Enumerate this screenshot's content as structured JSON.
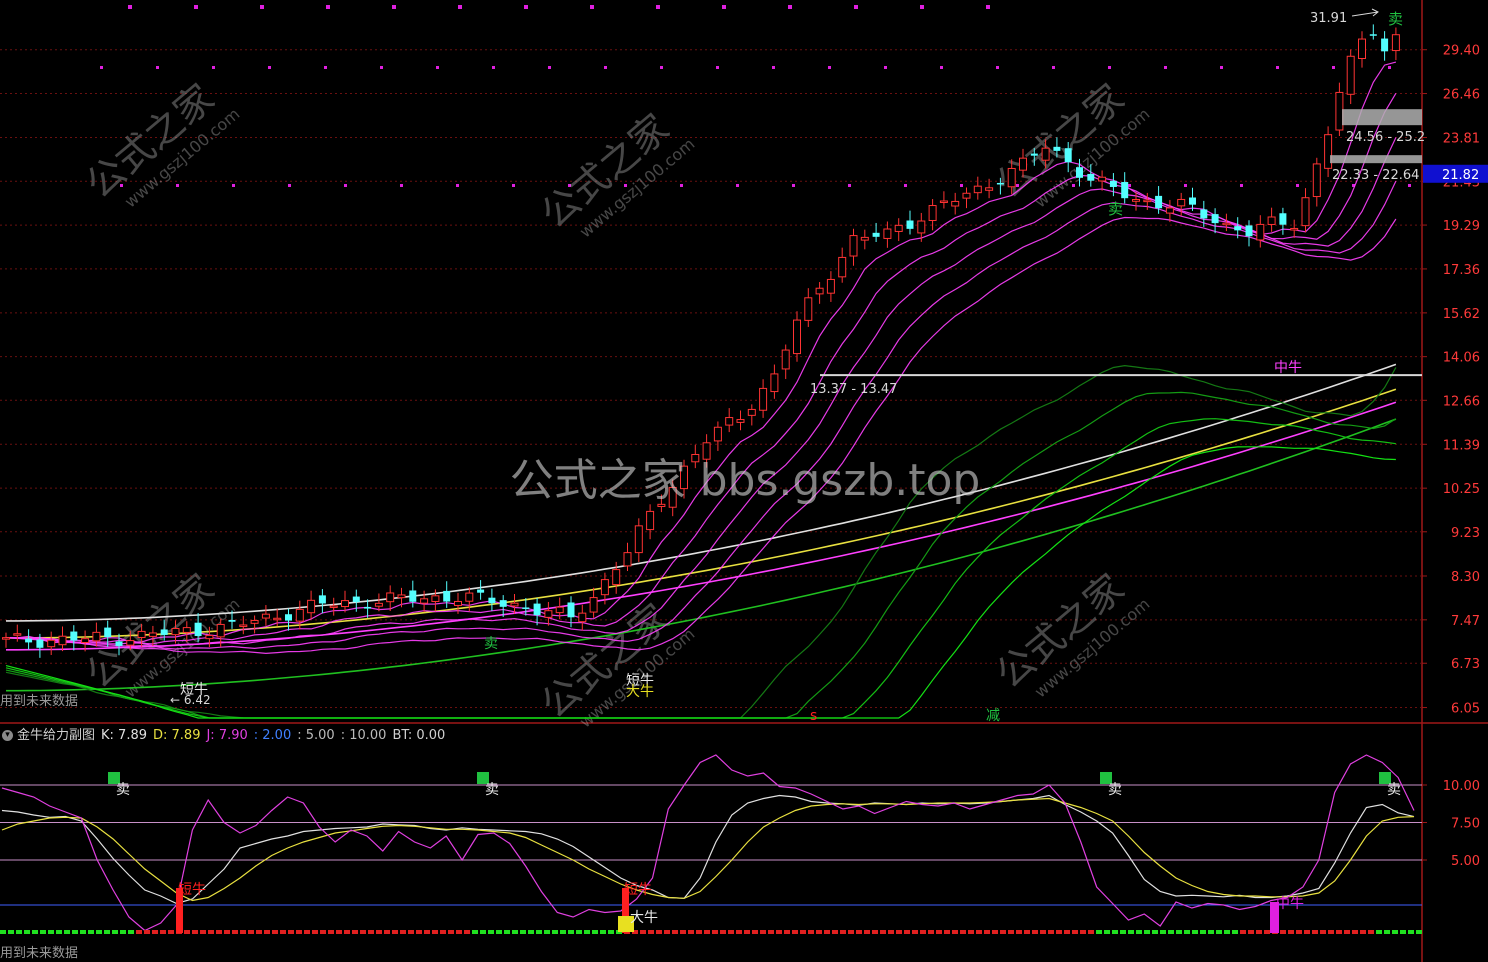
{
  "colors": {
    "background": "#000000",
    "frame": "#a01818",
    "grid": "#6a1010",
    "up": "#ff3333",
    "down": "#54ffff",
    "ma_short": "#ff40ff",
    "ma_long": "#20c020",
    "line_white": "#e0e0e0",
    "line_yellow": "#e8e040",
    "price_tag": "#1010d0",
    "k_line": "#e0e0e0",
    "d_line": "#e8e040",
    "j_line": "#e040e0",
    "level_blue": "#4060ff",
    "tick_text": "#ff3a3a",
    "signal_green": "#20c040",
    "signal_red": "#ff2020",
    "signal_yellow": "#e8e020",
    "signal_magenta": "#e020e0"
  },
  "watermark": {
    "center_text": "公式之家 bbs.gszb.top",
    "logo_cn": "公式之家",
    "logo_url": "www.gszj100.com"
  },
  "main_panel": {
    "footer_note": "用到未来数据",
    "current_price_tag": "21.82",
    "labels": {
      "sell": "卖",
      "short_bull": "短牛",
      "mid_bull": "中牛",
      "big_bull": "大牛",
      "reduce": "减",
      "s_mark": "s",
      "peak_value": "31.91",
      "low_value": "6.42"
    },
    "range_labels": [
      "13.37 - 13.47",
      "24.56 - 25.2",
      "22.33 - 22.64"
    ]
  },
  "sub_panel": {
    "name": "金牛给力副图",
    "k_label": "K: 7.89",
    "d_label": "D: 7.89",
    "j_label": "J: 7.90",
    "p1_label": ": 2.00",
    "p2_label": ": 5.00",
    "p3_label": ": 10.00",
    "bt_label": "BT: 0.00",
    "footer_note": "用到未来数据",
    "labels": {
      "sell": "卖",
      "short_bull": "短牛",
      "mid_bull": "中牛",
      "big_bull": "大牛"
    }
  },
  "chart_data": [
    {
      "type": "candlestick",
      "yaxis_scale": "log",
      "ylim": [
        5.9,
        32.5
      ],
      "ticks": [
        29.4,
        26.46,
        23.81,
        21.43,
        19.29,
        17.36,
        15.62,
        14.06,
        12.66,
        11.39,
        10.25,
        9.23,
        8.3,
        7.47,
        6.73,
        6.05
      ],
      "anchors": [
        [
          0,
          7.1
        ],
        [
          10,
          7.15
        ],
        [
          20,
          7.35
        ],
        [
          28,
          7.75
        ],
        [
          35,
          7.85
        ],
        [
          40,
          7.9
        ],
        [
          45,
          7.75
        ],
        [
          48,
          7.6
        ],
        [
          50,
          7.5
        ],
        [
          52,
          7.9
        ],
        [
          55,
          8.8
        ],
        [
          58,
          10.0
        ],
        [
          62,
          11.5
        ],
        [
          65,
          12.2
        ],
        [
          68,
          13.4
        ],
        [
          70,
          15.3
        ],
        [
          72,
          16.6
        ],
        [
          75,
          18.6
        ],
        [
          78,
          18.9
        ],
        [
          82,
          20.0
        ],
        [
          86,
          21.0
        ],
        [
          90,
          22.3
        ],
        [
          92,
          23.3
        ],
        [
          94,
          22.5
        ],
        [
          96,
          21.5
        ],
        [
          100,
          20.5
        ],
        [
          104,
          20.2
        ],
        [
          108,
          19.3
        ],
        [
          110,
          19.0
        ],
        [
          112,
          19.3
        ],
        [
          114,
          19.4
        ],
        [
          115,
          20.6
        ],
        [
          116,
          22.3
        ],
        [
          117,
          24.2
        ],
        [
          118,
          26.5
        ],
        [
          119,
          28.4
        ],
        [
          120,
          30.0
        ],
        [
          121,
          31.0
        ],
        [
          122,
          29.5
        ],
        [
          123,
          30.3
        ]
      ],
      "ma_short_offsets": [
        0.97,
        0.93,
        0.89,
        0.85,
        0.81
      ],
      "ma_long_offsets": [
        0.68,
        0.65,
        0.62,
        0.59
      ],
      "long_lines_start_end": {
        "white": [
          7.45,
          13.8
        ],
        "yellow": [
          7.15,
          13.0
        ],
        "magenta": [
          6.95,
          12.6
        ],
        "green": [
          6.3,
          12.1
        ]
      },
      "range_levels": [
        13.45,
        25.0,
        22.6
      ],
      "current_price": 21.82
    },
    {
      "type": "line",
      "series": [
        {
          "name": "K",
          "values": [
            8.3,
            8.2,
            8.0,
            7.85,
            7.9,
            7.6,
            6.4,
            5.1,
            4.0,
            3.0,
            2.6,
            2.1,
            2.4,
            3.4,
            4.4,
            5.8,
            6.1,
            6.4,
            6.6,
            6.9,
            7.0,
            7.1,
            7.15,
            7.2,
            7.4,
            7.35,
            7.3,
            7.1,
            7.0,
            7.15,
            7.05,
            7.0,
            6.95,
            6.9,
            6.75,
            6.4,
            5.9,
            5.2,
            4.5,
            3.8,
            3.3,
            3.0,
            2.5,
            2.45,
            3.8,
            6.2,
            8.0,
            8.8,
            9.1,
            9.3,
            9.2,
            8.9,
            8.8,
            8.75,
            8.65,
            8.8,
            8.75,
            8.7,
            8.8,
            8.75,
            8.8,
            8.75,
            8.8,
            8.9,
            9.0,
            9.1,
            9.3,
            8.7,
            8.2,
            7.6,
            6.8,
            5.3,
            3.7,
            2.9,
            2.6,
            2.65,
            2.6,
            2.55,
            2.65,
            2.5,
            2.5,
            2.6,
            2.8,
            3.1,
            4.8,
            6.8,
            8.5,
            8.7,
            8.15,
            7.89
          ]
        },
        {
          "name": "D",
          "values": [
            7.0,
            7.4,
            7.6,
            7.8,
            7.85,
            7.8,
            7.2,
            6.4,
            5.4,
            4.4,
            3.6,
            2.8,
            2.3,
            2.5,
            3.1,
            3.8,
            4.6,
            5.3,
            5.8,
            6.2,
            6.5,
            6.8,
            6.95,
            7.1,
            7.25,
            7.3,
            7.25,
            7.15,
            7.05,
            7.05,
            7.0,
            6.9,
            6.8,
            6.5,
            6.0,
            5.5,
            5.0,
            4.4,
            3.9,
            3.4,
            3.0,
            2.7,
            2.5,
            2.45,
            2.9,
            3.9,
            5.0,
            6.2,
            7.2,
            7.8,
            8.3,
            8.6,
            8.7,
            8.75,
            8.7,
            8.75,
            8.75,
            8.7,
            8.75,
            8.8,
            8.8,
            8.8,
            8.85,
            8.9,
            9.0,
            9.05,
            9.1,
            8.8,
            8.5,
            8.1,
            7.6,
            6.6,
            5.5,
            4.6,
            3.8,
            3.3,
            2.9,
            2.7,
            2.6,
            2.6,
            2.55,
            2.55,
            2.6,
            2.8,
            3.6,
            5.0,
            6.6,
            7.6,
            7.85,
            7.89
          ]
        },
        {
          "name": "J",
          "values": [
            9.8,
            9.5,
            9.2,
            8.6,
            8.2,
            7.8,
            5.0,
            3.0,
            1.2,
            0.3,
            0.8,
            2.0,
            7.0,
            9.0,
            7.5,
            6.8,
            7.3,
            8.3,
            9.2,
            8.8,
            7.2,
            6.2,
            7.0,
            6.6,
            5.6,
            6.9,
            6.2,
            5.8,
            6.6,
            5.0,
            6.7,
            6.8,
            6.1,
            4.6,
            2.9,
            1.5,
            1.2,
            1.7,
            1.5,
            1.6,
            2.4,
            3.8,
            8.4,
            10.0,
            11.5,
            12.0,
            11.0,
            10.6,
            10.8,
            9.9,
            9.8,
            9.4,
            8.9,
            8.4,
            8.6,
            8.1,
            8.5,
            8.9,
            8.7,
            8.6,
            8.8,
            8.4,
            8.7,
            9.0,
            9.3,
            9.4,
            10.0,
            8.8,
            6.2,
            3.2,
            2.1,
            1.0,
            1.4,
            0.6,
            2.2,
            1.8,
            2.1,
            2.0,
            1.7,
            1.9,
            2.3,
            2.5,
            3.2,
            5.0,
            9.5,
            11.4,
            12.0,
            11.5,
            10.5,
            8.3
          ]
        }
      ],
      "level_lines": [
        10.0,
        7.5,
        5.0,
        2.0
      ],
      "ylim": [
        0,
        12.6
      ],
      "ticks": [
        10.0,
        7.5,
        5.0
      ]
    }
  ]
}
